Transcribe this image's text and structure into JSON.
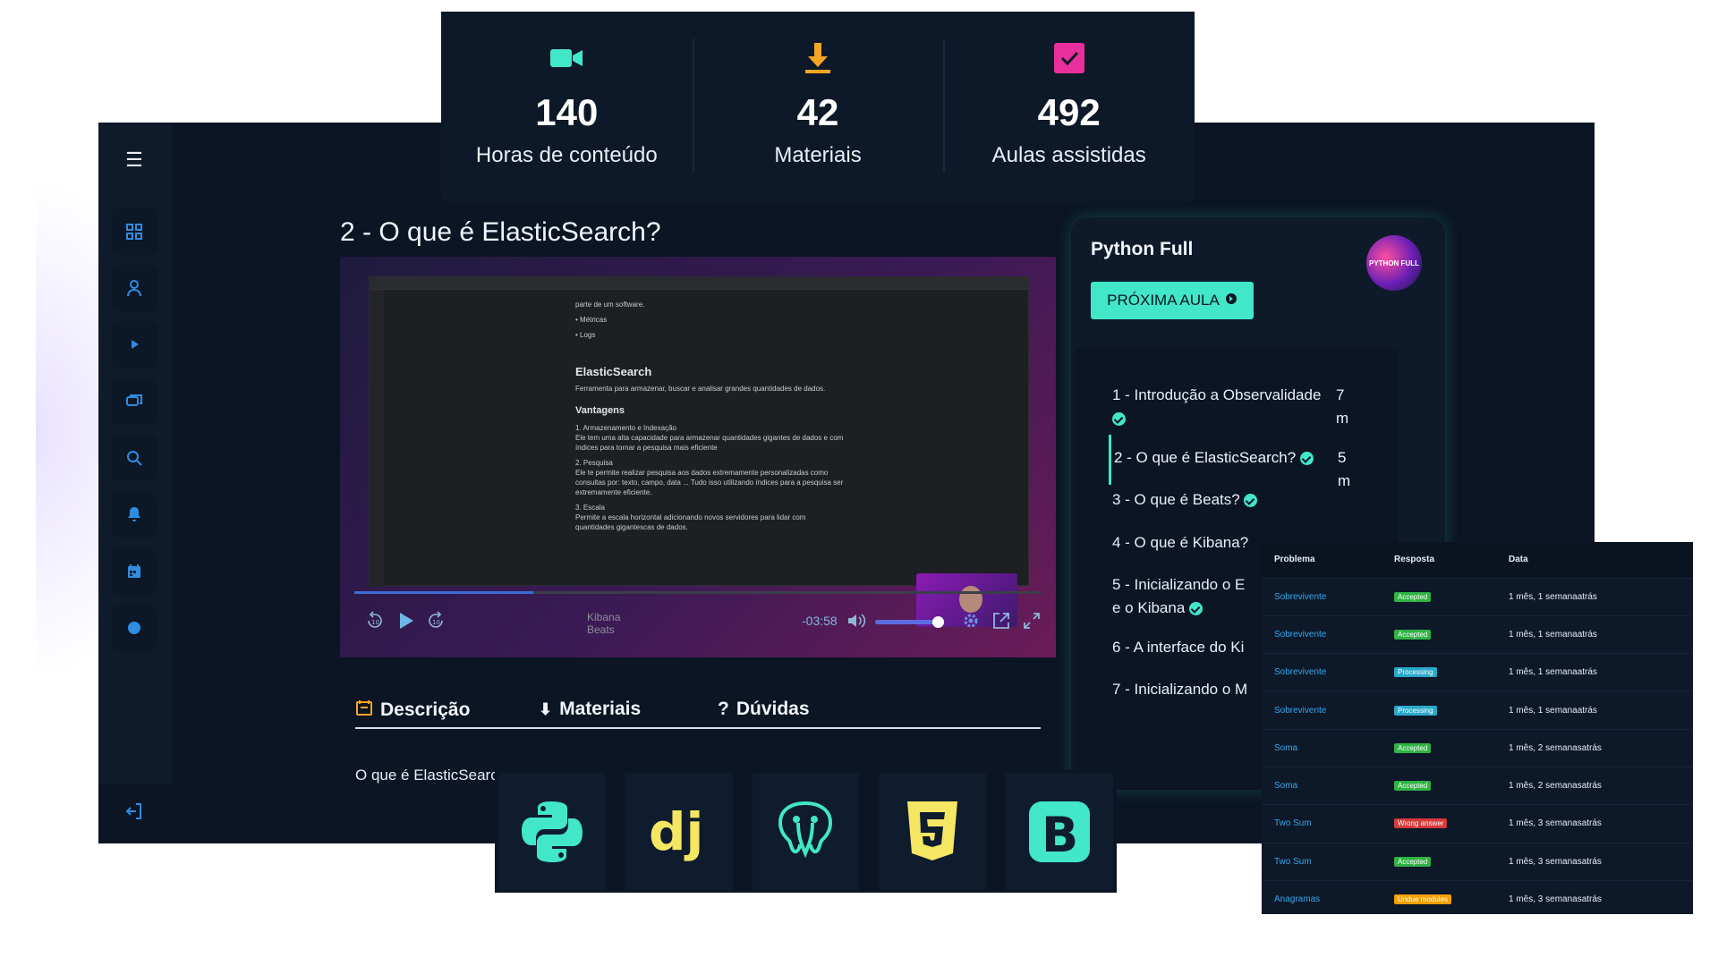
{
  "stats": [
    {
      "icon": "video-camera-icon",
      "value": "140",
      "label": "Horas de conteúdo",
      "color": "#42e6c8"
    },
    {
      "icon": "download-icon",
      "value": "42",
      "label": "Materiais",
      "color": "#f5a524"
    },
    {
      "icon": "checkbox-icon",
      "value": "492",
      "label": "Aulas assistidas",
      "color": "#e92f9b"
    }
  ],
  "sidebar": {
    "items": [
      {
        "icon": "dashboard-grid-icon"
      },
      {
        "icon": "user-icon"
      },
      {
        "icon": "play-icon"
      },
      {
        "icon": "chat-icon"
      },
      {
        "icon": "search-icon"
      },
      {
        "icon": "notification-bell-icon"
      },
      {
        "icon": "calendar-icon"
      },
      {
        "icon": "theme-circle-icon"
      }
    ],
    "logout_icon": "logout-icon",
    "accent": "#2f8de0"
  },
  "lesson": {
    "title": "2 - O que é ElasticSearch?"
  },
  "video": {
    "doc_lines_top": [
      "parte de um software.",
      "• Métricas",
      "• Logs"
    ],
    "doc_heading": "ElasticSearch",
    "doc_intro": "Ferramenta para armazenar, buscar e analisar grandes quantidades de dados.",
    "doc_subheading": "Vantagens",
    "doc_points": [
      "1. Armazenamento e Indexação",
      "Ele tem uma alta capacidade para armazenar quantidades gigantes de dados e com índices para tornar a pesquisa mais eficiente",
      "2. Pesquisa",
      "Ele te permite realizar pesquisa aos dados extremamente personalizadas como consultas por: texto, campo, data ... Tudo isso utilizando índices para a pesquisa ser extremamente eficiente.",
      "3. Escala",
      "Permite a escala horizontal adicionando novos servidores para lidar com quantidades gigantescas de dados."
    ],
    "chapters": [
      "Kibana",
      "Beats"
    ],
    "time_remaining": "-03:58",
    "progress": 0.26,
    "volume": 0.85
  },
  "tabs": [
    {
      "icon": "description-icon",
      "label": "Descrição"
    },
    {
      "icon": "download-icon",
      "label": "Materiais"
    },
    {
      "icon": "question-icon",
      "label": "Dúvidas"
    }
  ],
  "description": {
    "text": "O que é ElasticSearch?"
  },
  "course": {
    "title": "Python Full",
    "logo_text": "PYTHON FULL",
    "next_button": "PRÓXIMA AULA",
    "lessons": [
      {
        "title": "1 - Introdução a Observalidade",
        "duration": "7 m",
        "done": true,
        "active": false
      },
      {
        "title": "2 - O que é ElasticSearch?",
        "duration": "5 m",
        "done": true,
        "active": true
      },
      {
        "title": "3 - O que é Beats?",
        "duration": "",
        "done": true,
        "active": false
      },
      {
        "title": "4 - O que é Kibana?",
        "duration": "",
        "done": false,
        "active": false
      },
      {
        "title": "5 - Inicializando o E",
        "title2": "e o Kibana",
        "duration": "",
        "done": true,
        "active": false
      },
      {
        "title": "6 - A interface do Ki",
        "duration": "",
        "done": false,
        "active": false
      },
      {
        "title": "7 - Inicializando o M",
        "duration": "",
        "done": false,
        "active": false
      }
    ]
  },
  "tech": [
    {
      "icon": "python-icon"
    },
    {
      "icon": "django-icon"
    },
    {
      "icon": "postgresql-icon"
    },
    {
      "icon": "html5-icon"
    },
    {
      "icon": "bootstrap-icon"
    }
  ],
  "submissions": {
    "headers": [
      "Problema",
      "Resposta",
      "Data"
    ],
    "rows": [
      {
        "problem": "Sobrevivente",
        "status": "Accepted",
        "status_color": "#2fb344",
        "date": "1 mês, 1 semanaatrás"
      },
      {
        "problem": "Sobrevivente",
        "status": "Accepted",
        "status_color": "#2fb344",
        "date": "1 mês, 1 semanaatrás"
      },
      {
        "problem": "Sobrevivente",
        "status": "Processing",
        "status_color": "#2aa9c9",
        "date": "1 mês, 1 semanaatrás"
      },
      {
        "problem": "Sobrevivente",
        "status": "Processing",
        "status_color": "#2aa9c9",
        "date": "1 mês, 1 semanaatrás"
      },
      {
        "problem": "Soma",
        "status": "Accepted",
        "status_color": "#2fb344",
        "date": "1 mês, 2 semanasatrás"
      },
      {
        "problem": "Soma",
        "status": "Accepted",
        "status_color": "#2fb344",
        "date": "1 mês, 2 semanasatrás"
      },
      {
        "problem": "Two Sum",
        "status": "Wrong answer",
        "status_color": "#d63939",
        "date": "1 mês, 3 semanasatrás"
      },
      {
        "problem": "Two Sum",
        "status": "Accepted",
        "status_color": "#2fb344",
        "date": "1 mês, 3 semanasatrás"
      },
      {
        "problem": "Anagramas",
        "status": "Undue modules",
        "status_color": "#f59f00",
        "date": "1 mês, 3 semanasatrás"
      }
    ]
  }
}
